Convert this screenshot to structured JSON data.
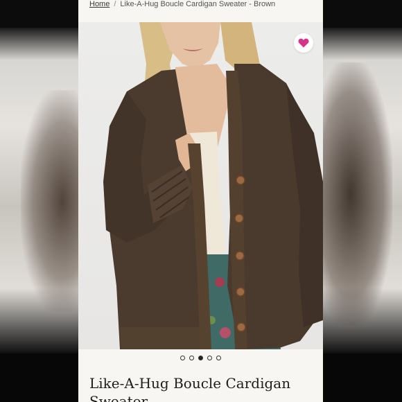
{
  "breadcrumb": {
    "home_label": "Home",
    "separator": "/",
    "current_label": "Like-A-Hug Boucle Cardigan Sweater - Brown"
  },
  "product": {
    "title": "Like-A-Hug Boucle Cardigan Sweater"
  },
  "wishlist": {
    "icon": "heart-icon",
    "color": "#d6338a"
  },
  "carousel": {
    "total": 5,
    "active_index": 2
  },
  "colors": {
    "sweater": "#4a3a2e",
    "background": "#f8f6f3"
  }
}
